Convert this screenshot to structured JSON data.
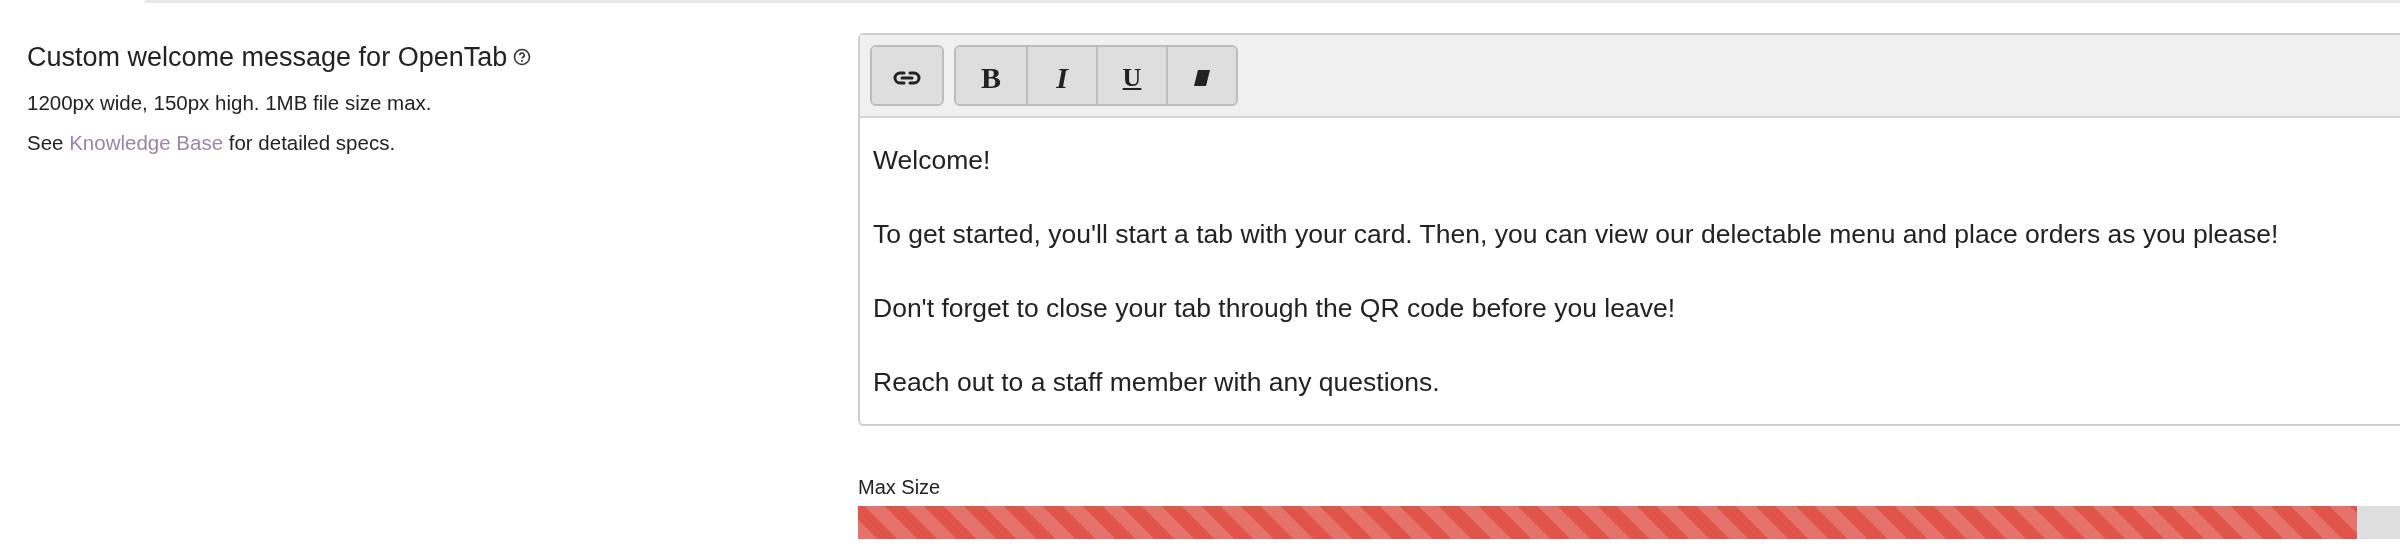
{
  "setting": {
    "label": "Custom welcome message for OpenTab",
    "hint_lines": [
      "1200px wide, 150px high. 1MB file size max."
    ],
    "see_text": {
      "before": "See",
      "link": "Knowledge Base",
      "after": "for detailed specs."
    }
  },
  "editor": {
    "toolbar_groups": [
      [
        {
          "kind": "link"
        }
      ],
      [
        {
          "kind": "bold",
          "text": "B"
        },
        {
          "kind": "italic",
          "text": "I"
        },
        {
          "kind": "underline",
          "text": "U"
        },
        {
          "kind": "clear"
        }
      ]
    ],
    "paragraphs": [
      "Welcome!",
      "To get started, you'll start a tab with your card. Then, you can view our delectable menu and place orders as you please!",
      "Don't forget to close your tab through the QR code before you leave!",
      "Reach out to a staff member with any questions."
    ]
  },
  "size_meter": {
    "label": "Max Size",
    "level": 0.972
  }
}
